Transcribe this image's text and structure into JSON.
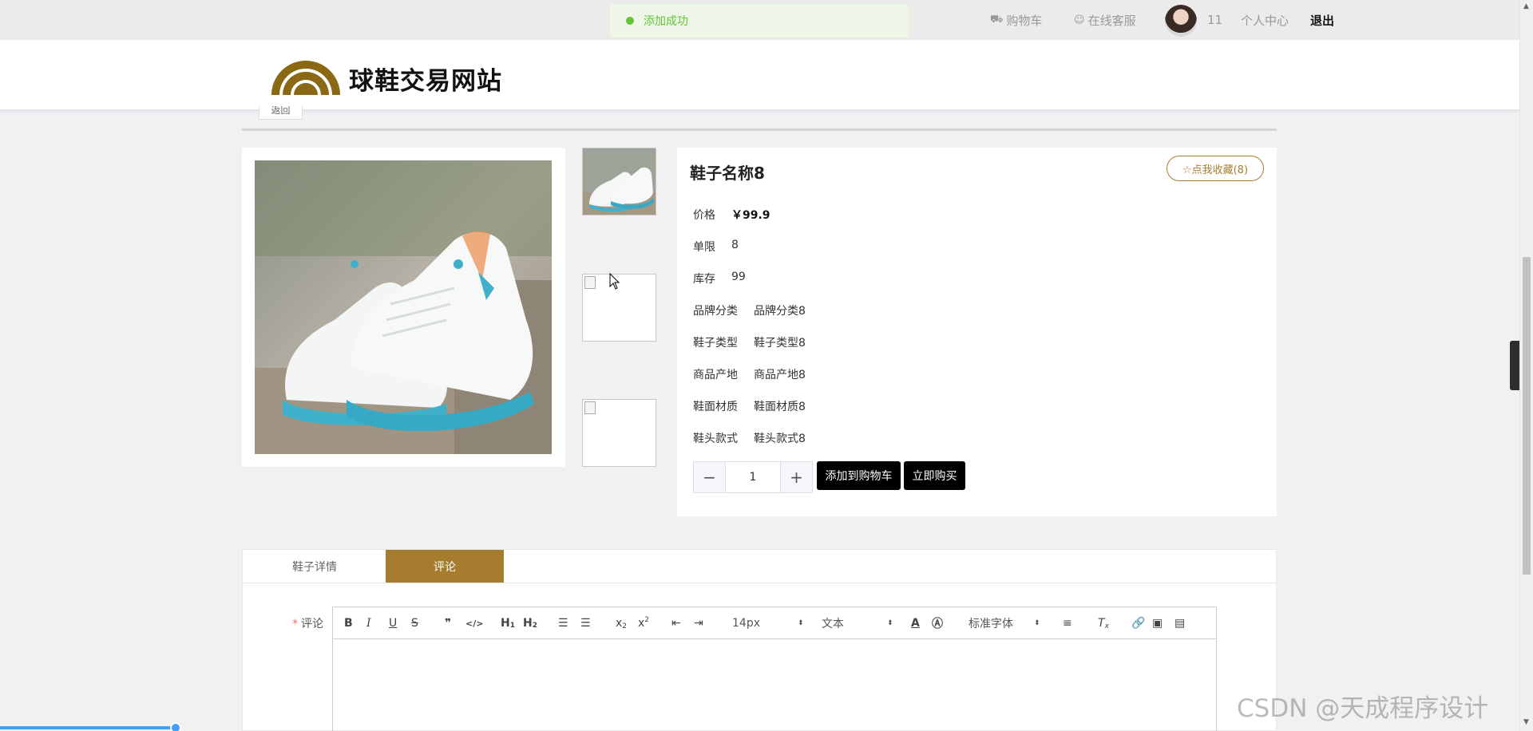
{
  "toast": {
    "message": "添加成功"
  },
  "topnav": {
    "cart_label": "购物车",
    "service_label": "在线客服",
    "username": "11",
    "user_center_label": "个人中心",
    "logout_label": "退出"
  },
  "header": {
    "site_title": "球鞋交易网站",
    "back_label": "返回"
  },
  "product": {
    "name": "鞋子名称8",
    "favorite_label": "☆点我收藏(8)",
    "attributes": [
      {
        "key": "价格",
        "value": "￥99.9"
      },
      {
        "key": "单限",
        "value": "8"
      },
      {
        "key": "库存",
        "value": "99"
      },
      {
        "key": "品牌分类",
        "value": "品牌分类8"
      },
      {
        "key": "鞋子类型",
        "value": "鞋子类型8"
      },
      {
        "key": "商品产地",
        "value": "商品产地8"
      },
      {
        "key": "鞋面材质",
        "value": "鞋面材质8"
      },
      {
        "key": "鞋头款式",
        "value": "鞋头款式8"
      }
    ],
    "quantity": "1",
    "add_to_cart_label": "添加到购物车",
    "buy_now_label": "立即购买"
  },
  "tabs": {
    "detail_label": "鞋子详情",
    "comment_label": "评论"
  },
  "comment": {
    "label": "评论",
    "required_mark": "*",
    "toolbar": {
      "font_size": "14px",
      "text_type": "文本",
      "font_family": "标准字体"
    }
  },
  "watermark": "CSDN @天成程序设计",
  "colors": {
    "accent": "#a67c2e",
    "toast_green": "#67c23a",
    "button_black": "#000000"
  }
}
